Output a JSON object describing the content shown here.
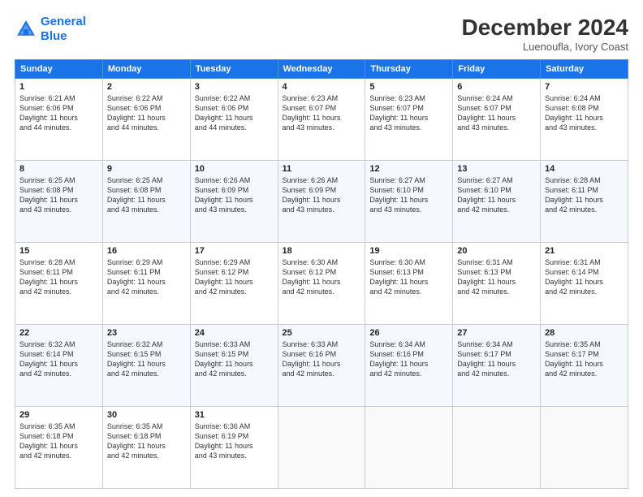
{
  "header": {
    "logo_line1": "General",
    "logo_line2": "Blue",
    "title": "December 2024",
    "subtitle": "Luenoufla, Ivory Coast"
  },
  "calendar": {
    "headers": [
      "Sunday",
      "Monday",
      "Tuesday",
      "Wednesday",
      "Thursday",
      "Friday",
      "Saturday"
    ],
    "rows": [
      [
        {
          "day": "1",
          "info": "Sunrise: 6:21 AM\nSunset: 6:06 PM\nDaylight: 11 hours\nand 44 minutes."
        },
        {
          "day": "2",
          "info": "Sunrise: 6:22 AM\nSunset: 6:06 PM\nDaylight: 11 hours\nand 44 minutes."
        },
        {
          "day": "3",
          "info": "Sunrise: 6:22 AM\nSunset: 6:06 PM\nDaylight: 11 hours\nand 44 minutes."
        },
        {
          "day": "4",
          "info": "Sunrise: 6:23 AM\nSunset: 6:07 PM\nDaylight: 11 hours\nand 43 minutes."
        },
        {
          "day": "5",
          "info": "Sunrise: 6:23 AM\nSunset: 6:07 PM\nDaylight: 11 hours\nand 43 minutes."
        },
        {
          "day": "6",
          "info": "Sunrise: 6:24 AM\nSunset: 6:07 PM\nDaylight: 11 hours\nand 43 minutes."
        },
        {
          "day": "7",
          "info": "Sunrise: 6:24 AM\nSunset: 6:08 PM\nDaylight: 11 hours\nand 43 minutes."
        }
      ],
      [
        {
          "day": "8",
          "info": "Sunrise: 6:25 AM\nSunset: 6:08 PM\nDaylight: 11 hours\nand 43 minutes."
        },
        {
          "day": "9",
          "info": "Sunrise: 6:25 AM\nSunset: 6:08 PM\nDaylight: 11 hours\nand 43 minutes."
        },
        {
          "day": "10",
          "info": "Sunrise: 6:26 AM\nSunset: 6:09 PM\nDaylight: 11 hours\nand 43 minutes."
        },
        {
          "day": "11",
          "info": "Sunrise: 6:26 AM\nSunset: 6:09 PM\nDaylight: 11 hours\nand 43 minutes."
        },
        {
          "day": "12",
          "info": "Sunrise: 6:27 AM\nSunset: 6:10 PM\nDaylight: 11 hours\nand 43 minutes."
        },
        {
          "day": "13",
          "info": "Sunrise: 6:27 AM\nSunset: 6:10 PM\nDaylight: 11 hours\nand 42 minutes."
        },
        {
          "day": "14",
          "info": "Sunrise: 6:28 AM\nSunset: 6:11 PM\nDaylight: 11 hours\nand 42 minutes."
        }
      ],
      [
        {
          "day": "15",
          "info": "Sunrise: 6:28 AM\nSunset: 6:11 PM\nDaylight: 11 hours\nand 42 minutes."
        },
        {
          "day": "16",
          "info": "Sunrise: 6:29 AM\nSunset: 6:11 PM\nDaylight: 11 hours\nand 42 minutes."
        },
        {
          "day": "17",
          "info": "Sunrise: 6:29 AM\nSunset: 6:12 PM\nDaylight: 11 hours\nand 42 minutes."
        },
        {
          "day": "18",
          "info": "Sunrise: 6:30 AM\nSunset: 6:12 PM\nDaylight: 11 hours\nand 42 minutes."
        },
        {
          "day": "19",
          "info": "Sunrise: 6:30 AM\nSunset: 6:13 PM\nDaylight: 11 hours\nand 42 minutes."
        },
        {
          "day": "20",
          "info": "Sunrise: 6:31 AM\nSunset: 6:13 PM\nDaylight: 11 hours\nand 42 minutes."
        },
        {
          "day": "21",
          "info": "Sunrise: 6:31 AM\nSunset: 6:14 PM\nDaylight: 11 hours\nand 42 minutes."
        }
      ],
      [
        {
          "day": "22",
          "info": "Sunrise: 6:32 AM\nSunset: 6:14 PM\nDaylight: 11 hours\nand 42 minutes."
        },
        {
          "day": "23",
          "info": "Sunrise: 6:32 AM\nSunset: 6:15 PM\nDaylight: 11 hours\nand 42 minutes."
        },
        {
          "day": "24",
          "info": "Sunrise: 6:33 AM\nSunset: 6:15 PM\nDaylight: 11 hours\nand 42 minutes."
        },
        {
          "day": "25",
          "info": "Sunrise: 6:33 AM\nSunset: 6:16 PM\nDaylight: 11 hours\nand 42 minutes."
        },
        {
          "day": "26",
          "info": "Sunrise: 6:34 AM\nSunset: 6:16 PM\nDaylight: 11 hours\nand 42 minutes."
        },
        {
          "day": "27",
          "info": "Sunrise: 6:34 AM\nSunset: 6:17 PM\nDaylight: 11 hours\nand 42 minutes."
        },
        {
          "day": "28",
          "info": "Sunrise: 6:35 AM\nSunset: 6:17 PM\nDaylight: 11 hours\nand 42 minutes."
        }
      ],
      [
        {
          "day": "29",
          "info": "Sunrise: 6:35 AM\nSunset: 6:18 PM\nDaylight: 11 hours\nand 42 minutes."
        },
        {
          "day": "30",
          "info": "Sunrise: 6:35 AM\nSunset: 6:18 PM\nDaylight: 11 hours\nand 42 minutes."
        },
        {
          "day": "31",
          "info": "Sunrise: 6:36 AM\nSunset: 6:19 PM\nDaylight: 11 hours\nand 43 minutes."
        },
        {
          "day": "",
          "info": ""
        },
        {
          "day": "",
          "info": ""
        },
        {
          "day": "",
          "info": ""
        },
        {
          "day": "",
          "info": ""
        }
      ]
    ]
  }
}
